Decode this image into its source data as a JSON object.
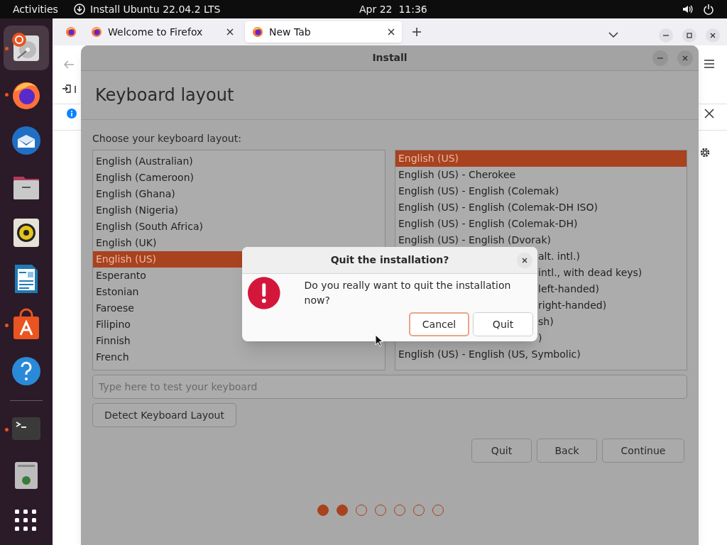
{
  "top_bar": {
    "activities": "Activities",
    "app_menu": "Install Ubuntu 22.04.2 LTS",
    "clock": "Apr 22  11:36"
  },
  "dock": {
    "items": [
      {
        "kind": "installer",
        "running": true,
        "active": true
      },
      {
        "kind": "firefox",
        "running": true,
        "active": false
      },
      {
        "kind": "thunderbird",
        "running": false,
        "active": false
      },
      {
        "kind": "files",
        "running": false,
        "active": false
      },
      {
        "kind": "rhythmbox",
        "running": false,
        "active": false
      },
      {
        "kind": "writer",
        "running": false,
        "active": false
      },
      {
        "kind": "software",
        "running": true,
        "active": false
      },
      {
        "kind": "help",
        "running": false,
        "active": false
      },
      {
        "kind": "terminal",
        "running": true,
        "active": false
      },
      {
        "kind": "trash",
        "running": false,
        "active": false
      },
      {
        "kind": "apps",
        "running": false,
        "active": false
      }
    ]
  },
  "browser": {
    "tabs": [
      {
        "label": "Welcome to Firefox",
        "selected": false
      },
      {
        "label": "New Tab",
        "selected": true
      }
    ],
    "covered_text": "I"
  },
  "installer": {
    "title": "Install",
    "heading": "Keyboard layout",
    "prompt": "Choose your keyboard layout:",
    "layouts": [
      {
        "label": "English (Australian)",
        "selected": false
      },
      {
        "label": "English (Cameroon)",
        "selected": false
      },
      {
        "label": "English (Ghana)",
        "selected": false
      },
      {
        "label": "English (Nigeria)",
        "selected": false
      },
      {
        "label": "English (South Africa)",
        "selected": false
      },
      {
        "label": "English (UK)",
        "selected": false
      },
      {
        "label": "English (US)",
        "selected": true
      },
      {
        "label": "Esperanto",
        "selected": false
      },
      {
        "label": "Estonian",
        "selected": false
      },
      {
        "label": "Faroese",
        "selected": false
      },
      {
        "label": "Filipino",
        "selected": false
      },
      {
        "label": "Finnish",
        "selected": false
      },
      {
        "label": "French",
        "selected": false
      }
    ],
    "variants": [
      {
        "kind": "full",
        "label": "English (US)",
        "selected": true
      },
      {
        "kind": "full",
        "label": "English (US) - Cherokee",
        "selected": false
      },
      {
        "kind": "full",
        "label": "English (US) - English (Colemak)",
        "selected": false
      },
      {
        "kind": "full",
        "label": "English (US) - English (Colemak-DH ISO)",
        "selected": false
      },
      {
        "kind": "full",
        "label": "English (US) - English (Colemak-DH)",
        "selected": false
      },
      {
        "kind": "full",
        "label": "English (US) - English (Dvorak)",
        "selected": false
      },
      {
        "kind": "covered",
        "label": "alt. intl.)",
        "selected": false
      },
      {
        "kind": "covered",
        "label": "intl., with dead keys)",
        "selected": false
      },
      {
        "kind": "covered",
        "label": "left-handed)",
        "selected": false
      },
      {
        "kind": "covered",
        "label": "right-handed)",
        "selected": false
      },
      {
        "kind": "covered",
        "label": "sh)",
        "selected": false
      },
      {
        "kind": "covered",
        "label": ")",
        "selected": false
      },
      {
        "kind": "full",
        "label": "English (US) - English (US, Symbolic)",
        "selected": false
      }
    ],
    "test_field": {
      "placeholder": "Type here to test your keyboard"
    },
    "detect_button": "Detect Keyboard Layout",
    "buttons": [
      "Quit",
      "Back",
      "Continue"
    ],
    "steps": [
      {
        "completed": true
      },
      {
        "completed": true
      },
      {
        "completed": false
      },
      {
        "completed": false
      },
      {
        "completed": false
      },
      {
        "completed": false
      },
      {
        "completed": false
      }
    ]
  },
  "dialog": {
    "title": "Quit the installation?",
    "message": "Do you really want to quit the installation now?",
    "buttons": [
      {
        "label": "Cancel",
        "default": true
      },
      {
        "label": "Quit",
        "default": false
      }
    ]
  }
}
